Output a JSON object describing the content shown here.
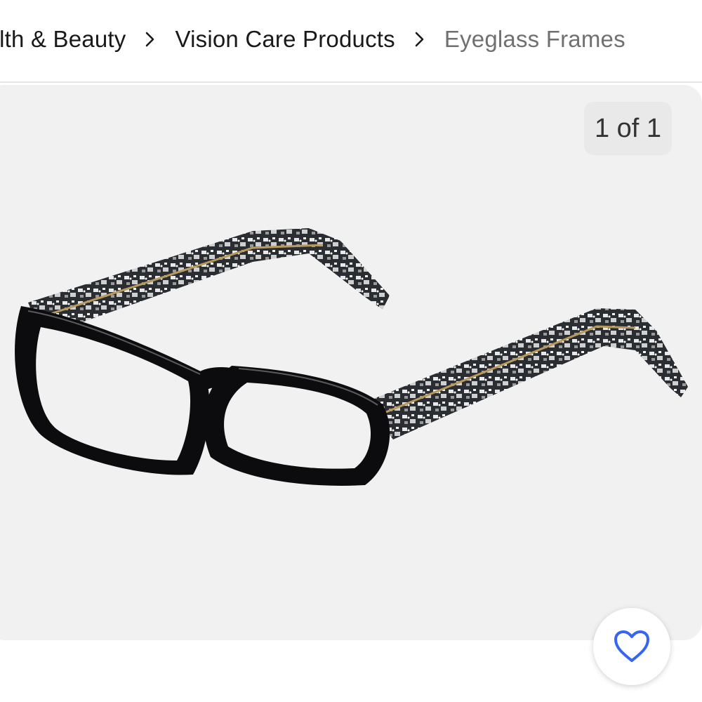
{
  "breadcrumb": {
    "items": [
      {
        "label": "Health & Beauty"
      },
      {
        "label": "Vision Care Products"
      },
      {
        "label": "Eyeglass Frames"
      }
    ]
  },
  "gallery": {
    "counter": "1 of 1",
    "image_subject": "black rectangular eyeglass frames with black and white lace-pattern temples"
  },
  "icons": {
    "separator": "chevron-right-icon",
    "watch": "heart-icon"
  },
  "colors": {
    "watch_icon": "#3665f3",
    "gallery_bg": "#f1f1f1",
    "crumb_text": "#191919",
    "crumb_current": "#707070"
  }
}
